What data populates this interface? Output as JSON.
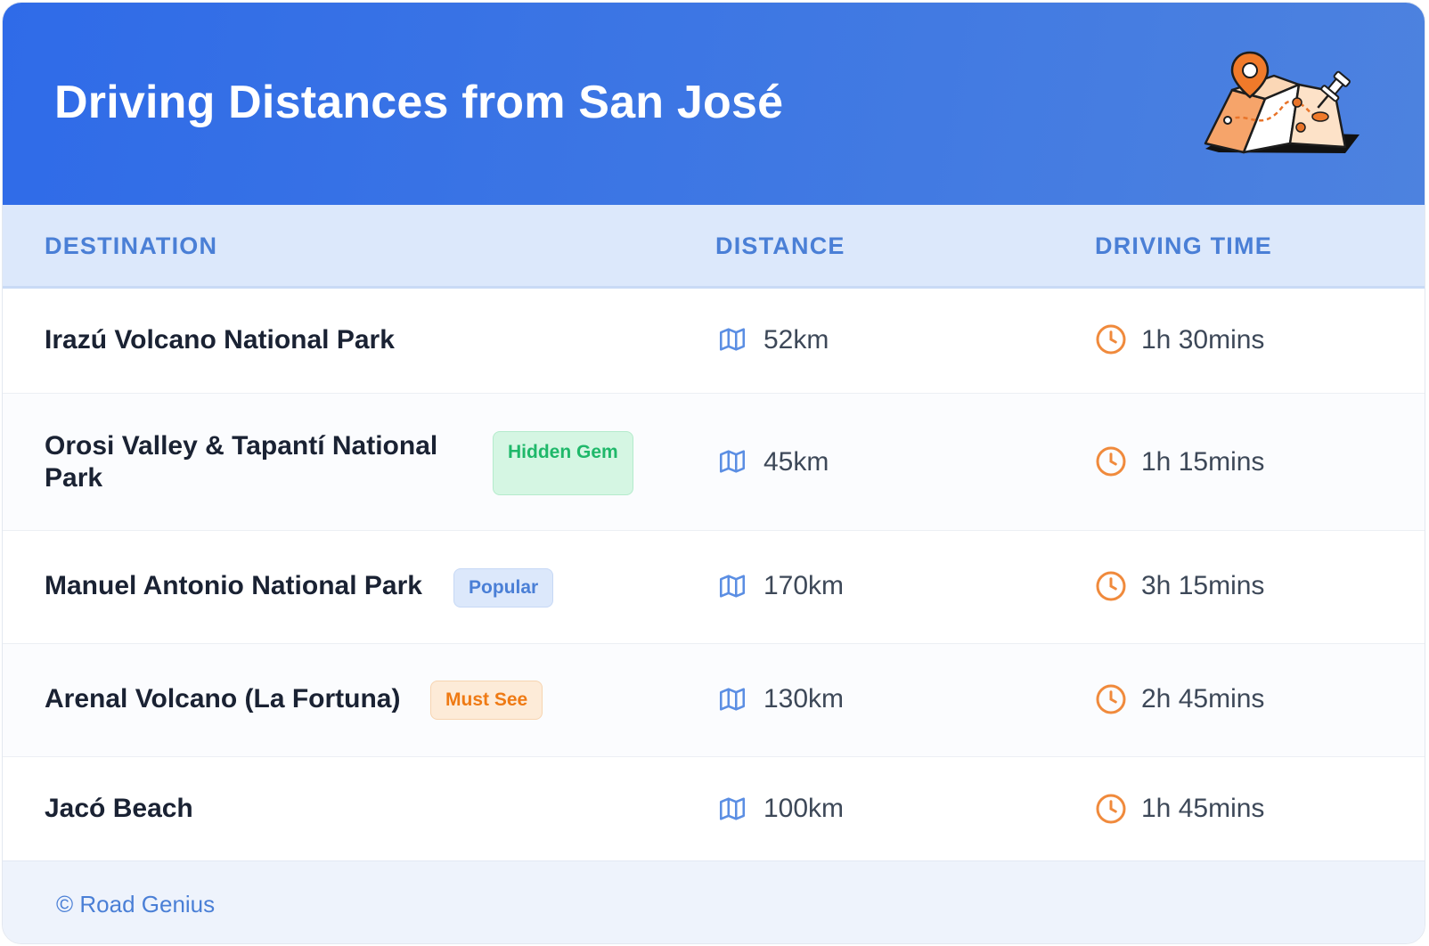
{
  "header": {
    "title": "Driving Distances from San José",
    "illustration_icon": "folded-map-with-pins-icon"
  },
  "table": {
    "columns": [
      "DESTINATION",
      "DISTANCE",
      "DRIVING TIME"
    ],
    "rows": [
      {
        "destination": "Irazú Volcano National Park",
        "badge": "",
        "distance": "52km",
        "time": "1h 30mins"
      },
      {
        "destination": "Orosi Valley & Tapantí National Park",
        "badge": "Hidden Gem",
        "badge_color": "green",
        "distance": "45km",
        "time": "1h 15mins"
      },
      {
        "destination": "Manuel Antonio National Park",
        "badge": "Popular",
        "badge_color": "blue",
        "distance": "170km",
        "time": "3h 15mins"
      },
      {
        "destination": "Arenal Volcano (La Fortuna)",
        "badge": "Must See",
        "badge_color": "orange",
        "distance": "130km",
        "time": "2h 45mins"
      },
      {
        "destination": "Jacó Beach",
        "badge": "",
        "distance": "100km",
        "time": "1h 45mins"
      }
    ],
    "distance_icon": "map-icon",
    "time_icon": "clock-icon"
  },
  "footer": {
    "text": "© Road Genius"
  },
  "colors": {
    "header_gradient_start": "#2f6be8",
    "header_gradient_end": "#4d82df",
    "accent_blue": "#4a7fd6",
    "accent_orange": "#f08a3c",
    "badge_green": "#1fb86a"
  }
}
